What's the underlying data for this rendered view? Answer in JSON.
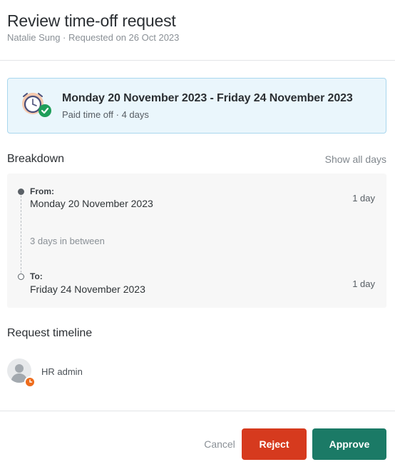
{
  "header": {
    "title": "Review time-off request",
    "subtitle": "Natalie Sung · Requested on 26 Oct 2023"
  },
  "summary": {
    "dates": "Monday 20 November 2023 - Friday 24 November 2023",
    "meta": "Paid time off · 4 days",
    "icon": "clock-approved-icon"
  },
  "breakdown": {
    "title": "Breakdown",
    "show_all": "Show all days",
    "from_label": "From:",
    "from_date": "Monday 20 November 2023",
    "from_days": "1 day",
    "between": "3 days in between",
    "to_label": "To:",
    "to_date": "Friday 24 November 2023",
    "to_days": "1 day"
  },
  "timeline": {
    "title": "Request timeline",
    "entries": [
      {
        "name": "HR admin",
        "status_color": "#ee6c1c"
      }
    ]
  },
  "actions": {
    "cancel": "Cancel",
    "reject": "Reject",
    "approve": "Approve"
  },
  "colors": {
    "reject": "#d63a1e",
    "approve": "#1b7a66",
    "summary_bg": "#eaf6fc"
  }
}
